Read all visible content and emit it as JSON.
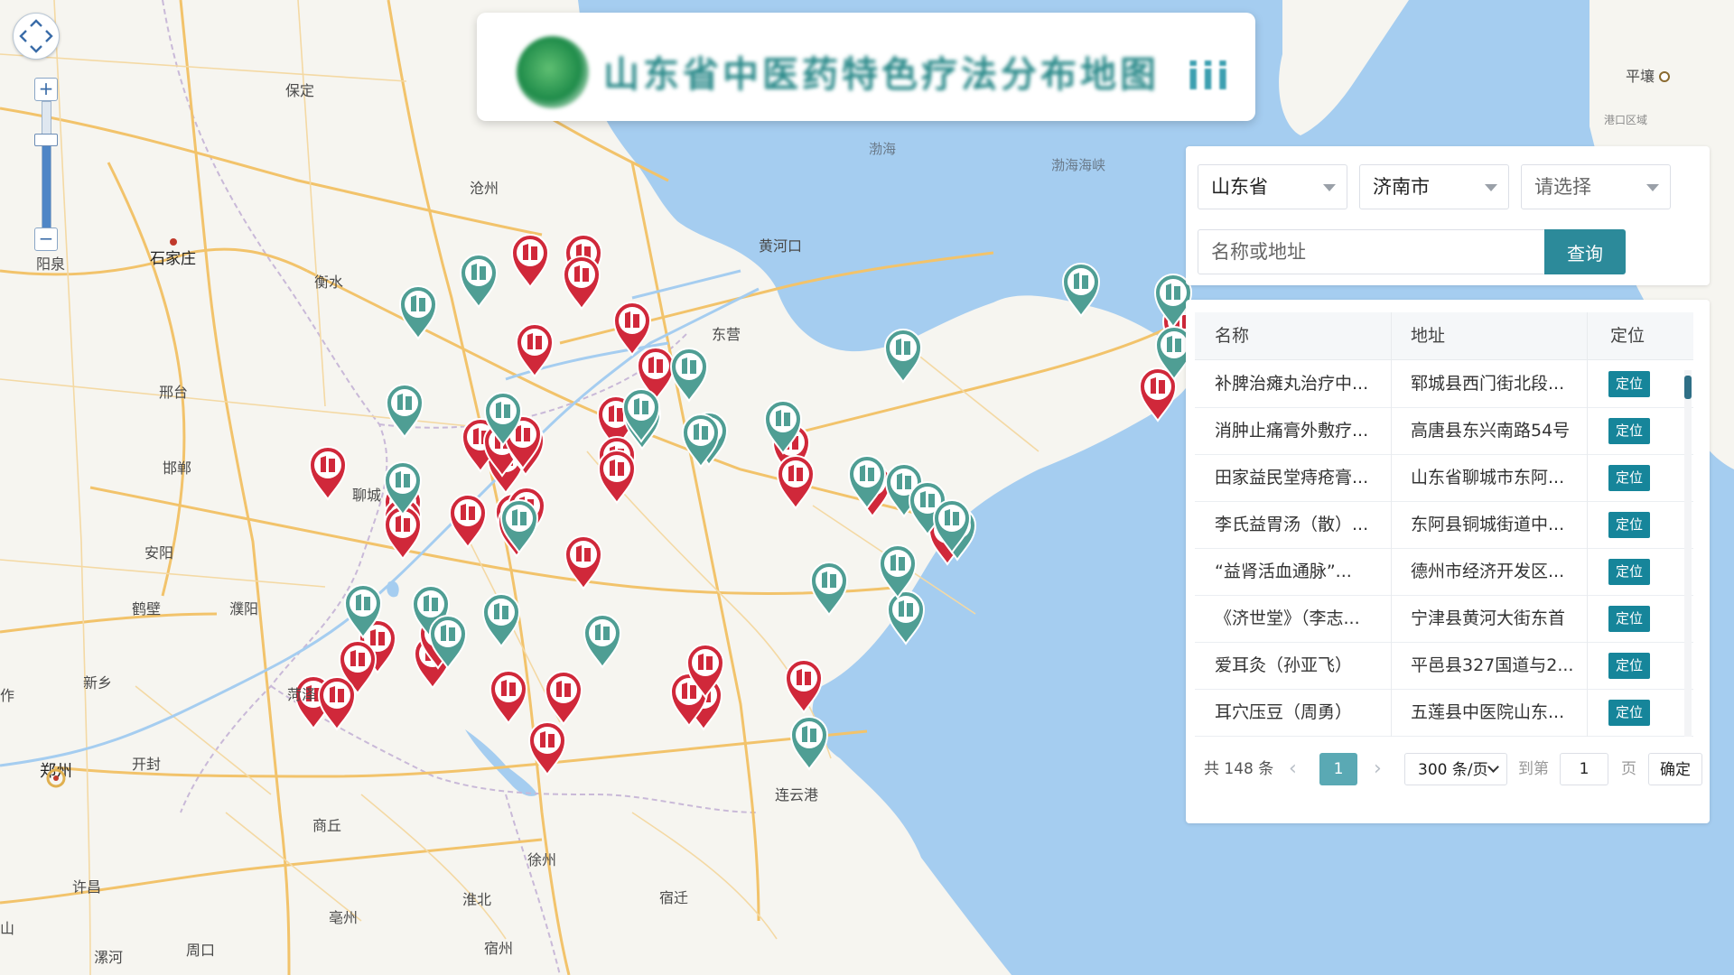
{
  "map": {
    "labels": [
      {
        "id": "pingrang",
        "text": "平壤"
      },
      {
        "id": "gangdong",
        "text": "港口区域"
      },
      {
        "id": "bohai",
        "text": "渤海"
      },
      {
        "id": "bohai_strait",
        "text": "渤海海峡"
      },
      {
        "id": "baoding",
        "text": "保定"
      },
      {
        "id": "cangzhou",
        "text": "沧州"
      },
      {
        "id": "shijiazhuang",
        "text": "石家庄"
      },
      {
        "id": "yangquan",
        "text": "阳泉"
      },
      {
        "id": "hengshui",
        "text": "衡水"
      },
      {
        "id": "huanghekou",
        "text": "黄河口"
      },
      {
        "id": "dongying",
        "text": "东营"
      },
      {
        "id": "xingtai",
        "text": "邢台"
      },
      {
        "id": "handan",
        "text": "邯郸"
      },
      {
        "id": "liaocheng",
        "text": "聊城"
      },
      {
        "id": "anyang",
        "text": "安阳"
      },
      {
        "id": "hebi",
        "text": "鹤壁"
      },
      {
        "id": "puyang",
        "text": "濮阳"
      },
      {
        "id": "xinxiang",
        "text": "新乡"
      },
      {
        "id": "heze",
        "text": "菏泽"
      },
      {
        "id": "zuo",
        "text": "作"
      },
      {
        "id": "zhengzhou",
        "text": "郑州"
      },
      {
        "id": "kaifeng",
        "text": "开封"
      },
      {
        "id": "shangqiu",
        "text": "商丘"
      },
      {
        "id": "xuchang",
        "text": "许昌"
      },
      {
        "id": "xuzhou",
        "text": "徐州"
      },
      {
        "id": "lianyungang",
        "text": "连云港"
      },
      {
        "id": "huaibei",
        "text": "淮北"
      },
      {
        "id": "suqian",
        "text": "宿迁"
      },
      {
        "id": "bozhou",
        "text": "亳州"
      },
      {
        "id": "suzhou",
        "text": "宿州"
      },
      {
        "id": "zhoukou",
        "text": "周口"
      },
      {
        "id": "luohe",
        "text": "漯河"
      },
      {
        "id": "shan",
        "text": "山"
      }
    ],
    "marker_colors": {
      "red": "#d0283a",
      "teal": "#4f9e94"
    },
    "markers": {
      "red": [
        [
          587,
          318
        ],
        [
          646,
          318
        ],
        [
          644,
          342
        ],
        [
          700,
          393
        ],
        [
          726,
          443
        ],
        [
          682,
          497
        ],
        [
          592,
          417
        ],
        [
          560,
          546
        ],
        [
          363,
          553
        ],
        [
          532,
          522
        ],
        [
          556,
          527
        ],
        [
          582,
          526
        ],
        [
          683,
          542
        ],
        [
          683,
          557
        ],
        [
          446,
          594
        ],
        [
          446,
          610
        ],
        [
          446,
          619
        ],
        [
          518,
          606
        ],
        [
          579,
          519
        ],
        [
          569,
          605
        ],
        [
          572,
          616
        ],
        [
          583,
          598
        ],
        [
          646,
          652
        ],
        [
          479,
          762
        ],
        [
          485,
          740
        ],
        [
          418,
          745
        ],
        [
          396,
          768
        ],
        [
          347,
          807
        ],
        [
          373,
          808
        ],
        [
          563,
          801
        ],
        [
          624,
          802
        ],
        [
          779,
          808
        ],
        [
          606,
          858
        ],
        [
          763,
          804
        ],
        [
          781,
          772
        ],
        [
          890,
          789
        ],
        [
          876,
          528
        ],
        [
          881,
          563
        ],
        [
          966,
          572
        ],
        [
          1049,
          625
        ],
        [
          1282,
          466
        ],
        [
          1308,
          394
        ]
      ],
      "teal": [
        [
          463,
          375
        ],
        [
          530,
          340
        ],
        [
          448,
          484
        ],
        [
          557,
          493
        ],
        [
          711,
          497
        ],
        [
          763,
          444
        ],
        [
          710,
          489
        ],
        [
          785,
          515
        ],
        [
          446,
          570
        ],
        [
          575,
          612
        ],
        [
          776,
          517
        ],
        [
          867,
          502
        ],
        [
          1000,
          423
        ],
        [
          1197,
          350
        ],
        [
          1003,
          713
        ],
        [
          1001,
          572
        ],
        [
          1027,
          592
        ],
        [
          1060,
          620
        ],
        [
          1054,
          612
        ],
        [
          896,
          852
        ],
        [
          1299,
          362
        ],
        [
          1300,
          420
        ],
        [
          960,
          563
        ],
        [
          994,
          662
        ],
        [
          402,
          706
        ],
        [
          477,
          707
        ],
        [
          496,
          740
        ],
        [
          555,
          716
        ],
        [
          667,
          739
        ],
        [
          918,
          681
        ]
      ]
    }
  },
  "zoom": {
    "level_fraction": 0.7
  },
  "title": {
    "text": "山东省中医药特色疗法分布地图",
    "deco": "iii"
  },
  "search": {
    "province": "山东省",
    "city": "济南市",
    "district_placeholder": "请选择",
    "keyword_placeholder": "名称或地址",
    "query_label": "查询"
  },
  "table": {
    "headers": {
      "name": "名称",
      "address": "地址",
      "locate": "定位"
    },
    "locate_label": "定位",
    "rows": [
      {
        "name": "补脾治瘫丸治疗中...",
        "address": "郓城县西门街北段..."
      },
      {
        "name": "消肿止痛膏外敷疗...",
        "address": "高唐县东兴南路54号"
      },
      {
        "name": "田家益民堂痔疮膏...",
        "address": "山东省聊城市东阿..."
      },
      {
        "name": "李氏益胃汤（散）...",
        "address": "东阿县铜城街道中..."
      },
      {
        "name": "“益肾活血通脉”...",
        "address": "德州市经济开发区..."
      },
      {
        "name": "《济世堂》（李志...",
        "address": "宁津县黄河大街东首"
      },
      {
        "name": "爱耳灸（孙亚飞）",
        "address": "平邑县327国道与2..."
      },
      {
        "name": "耳穴压豆（周勇）",
        "address": "五莲县中医院山东..."
      }
    ]
  },
  "pager": {
    "total": "共 148 条",
    "current": "1",
    "page_size": "300 条/页",
    "goto_prefix": "到第",
    "goto_value": "1",
    "goto_suffix": "页",
    "confirm": "确定"
  }
}
